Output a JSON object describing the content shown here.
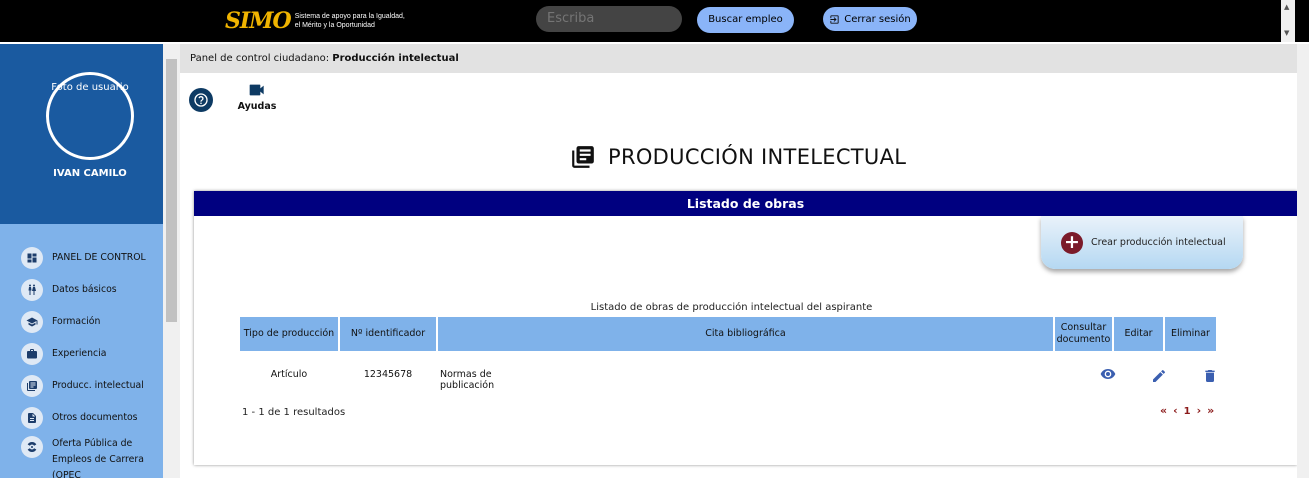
{
  "topbar": {
    "logo_mark": "SIMO",
    "logo_text_line1": "Sistema de apoyo para la Igualdad,",
    "logo_text_line2": "el Mérito y la Oportunidad",
    "search_placeholder": "Escriba",
    "search_button": "Buscar empleo",
    "logout_button": "Cerrar sesión"
  },
  "sidebar": {
    "avatar_alt": "Foto de usuario",
    "user_name": "IVAN CAMILO",
    "items": [
      {
        "label": "PANEL DE CONTROL",
        "icon": "dashboard-icon"
      },
      {
        "label": "Datos básicos",
        "icon": "people-icon"
      },
      {
        "label": "Formación",
        "icon": "school-icon"
      },
      {
        "label": "Experiencia",
        "icon": "briefcase-icon"
      },
      {
        "label": "Producc. intelectual",
        "icon": "library-books-icon"
      },
      {
        "label": "Otros documentos",
        "icon": "document-icon"
      },
      {
        "label": "Oferta Pública de Empleos de Carrera (OPEC",
        "icon": "radiation-icon"
      }
    ]
  },
  "breadcrumb": {
    "prefix": "Panel de control ciudadano:",
    "current": "Producción intelectual"
  },
  "help": {
    "ayudas_label": "Ayudas"
  },
  "page": {
    "title": "PRODUCCIÓN INTELECTUAL"
  },
  "card": {
    "header": "Listado de obras",
    "create_button": "Crear producción intelectual",
    "table_caption": "Listado de obras de producción intelectual del aspirante",
    "columns": [
      "Tipo de producción",
      "Nº identificador",
      "Cita bibliográfica",
      "Consultar documento",
      "Editar",
      "Eliminar"
    ],
    "rows": [
      {
        "tipo": "Artículo",
        "identificador": "12345678",
        "cita": "Normas de publicación"
      }
    ],
    "result_count": "1 - 1 de 1 resultados",
    "pager": {
      "first": "«",
      "prev": "‹",
      "page": "1",
      "next": "›",
      "last": "»"
    }
  },
  "colors": {
    "topbar": "#000000",
    "sidebar_head": "#1a5aa0",
    "sidebar": "#7fb2ea",
    "card_header": "#000080",
    "table_header": "#7fb2ea",
    "accent_icon": "#3b5fb0",
    "pager": "#8b1a1a"
  }
}
